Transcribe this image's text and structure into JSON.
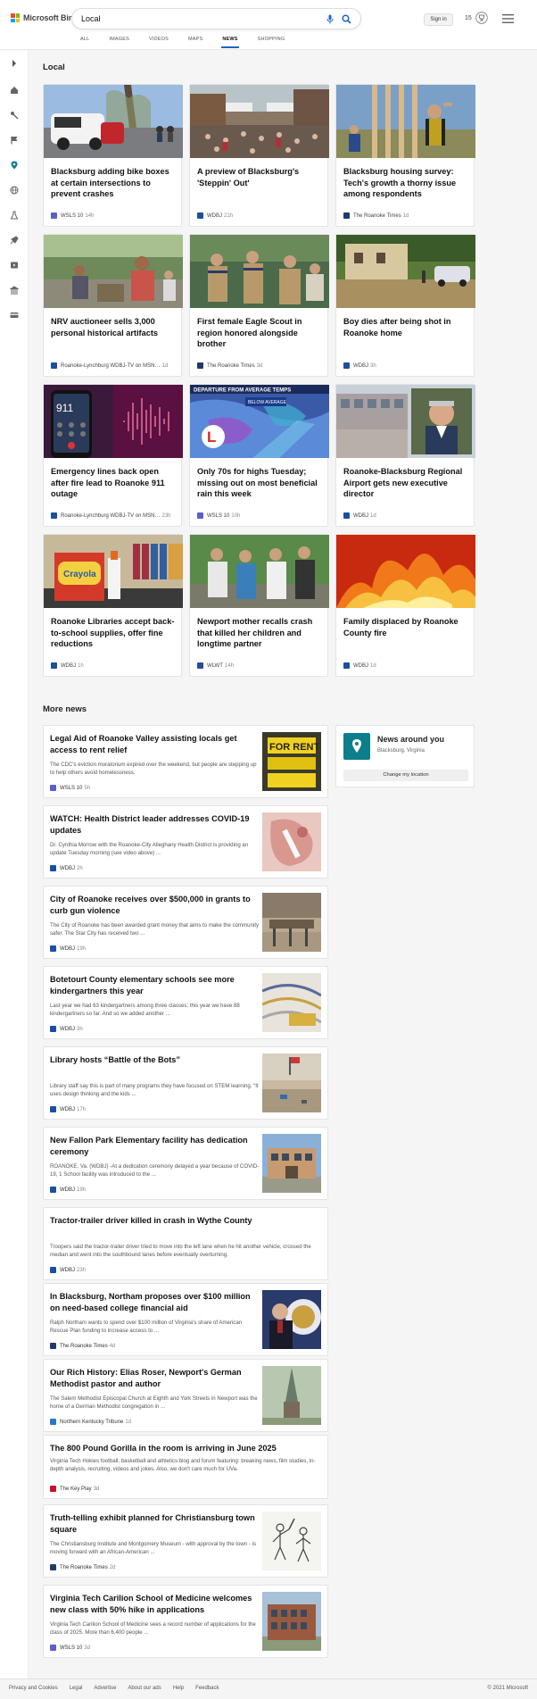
{
  "brand": {
    "name": "Microsoft Bing",
    "logo_colors": [
      "#f25022",
      "#7fba00",
      "#00a4ef",
      "#ffb900"
    ],
    "accent": "#1e65c9"
  },
  "search": {
    "query": "Local"
  },
  "header": {
    "sign_in": "Sign in",
    "reward_points": "15"
  },
  "tabs": [
    {
      "label": "ALL",
      "active": false
    },
    {
      "label": "IMAGES",
      "active": false
    },
    {
      "label": "VIDEOS",
      "active": false
    },
    {
      "label": "MAPS",
      "active": false
    },
    {
      "label": "NEWS",
      "active": true
    },
    {
      "label": "SHOPPING",
      "active": false
    }
  ],
  "sidebar": {
    "icons": [
      "expand-icon",
      "home-icon",
      "sports-icon",
      "flag-icon",
      "local-pin-icon",
      "world-icon",
      "science-icon",
      "tech-icon",
      "entertainment-icon",
      "politics-icon",
      "money-icon"
    ]
  },
  "local": {
    "heading": "Local",
    "cards": [
      {
        "title": "Blacksburg adding bike boxes at certain intersections to prevent crashes",
        "source": "WSLS 10",
        "time": "14h",
        "source_color": "#5b5fc7"
      },
      {
        "title": "A preview of Blacksburg's 'Steppin' Out'",
        "source": "WDBJ",
        "time": "21h",
        "source_color": "#1b4fa0"
      },
      {
        "title": "Blacksburg housing survey: Tech's growth a thorny issue among respondents",
        "source": "The Roanoke Times",
        "time": "1d",
        "source_color": "#1f3a6b"
      },
      {
        "title": "NRV auctioneer sells 3,000 personal historical artifacts",
        "source": "Roanoke-Lynchburg WDBJ-TV on MSN…",
        "time": "1d",
        "source_color": "#1b4fa0"
      },
      {
        "title": "First female Eagle Scout in region honored alongside brother",
        "source": "The Roanoke Times",
        "time": "3d",
        "source_color": "#1f3a6b"
      },
      {
        "title": "Boy dies after being shot in Roanoke home",
        "source": "WDBJ",
        "time": "3h",
        "source_color": "#1b4fa0"
      },
      {
        "title": "Emergency lines back open after fire lead to Roanoke 911 outage",
        "source": "Roanoke-Lynchburg WDBJ-TV on MSN…",
        "time": "23h",
        "source_color": "#1b4fa0"
      },
      {
        "title": "Only 70s for highs Tuesday; missing out on most beneficial rain this week",
        "source": "WSLS 10",
        "time": "10h",
        "source_color": "#5b5fc7"
      },
      {
        "title": "Roanoke-Blacksburg Regional Airport gets new executive director",
        "source": "WDBJ",
        "time": "1d",
        "source_color": "#1b4fa0"
      },
      {
        "title": "Roanoke Libraries accept back-to-school supplies, offer fine reductions",
        "source": "WDBJ",
        "time": "1h",
        "source_color": "#1b4fa0"
      },
      {
        "title": "Newport mother recalls crash that killed her children and longtime partner",
        "source": "WLWT",
        "time": "14h",
        "source_color": "#2b4a9b"
      },
      {
        "title": "Family displaced by Roanoke County fire",
        "source": "WDBJ",
        "time": "1d",
        "source_color": "#1b4fa0"
      }
    ],
    "overlay_text": {
      "weather_banner": "DEPARTURE FROM AVERAGE TEMPS",
      "weather_badge": "BELOW AVERAGE",
      "weather_logo": "L",
      "rent_sign": "FOR RENT"
    }
  },
  "more_news": {
    "heading": "More news",
    "items": [
      {
        "title": "Legal Aid of Roanoke Valley assisting locals get access to rent relief",
        "snippet": "The CDC's eviction moratorium expired over the weekend, but people are stepping up to help others avoid homelessness.",
        "source": "WSLS 10",
        "time": "5h",
        "source_color": "#5b5fc7"
      },
      {
        "title": "WATCH: Health District leader addresses COVID-19 updates",
        "snippet": "Dr. Cynthia Morrow with the Roanoke-City Alleghany Health District is providing an update Tuesday morning (see video above) ...",
        "source": "WDBJ",
        "time": "2h",
        "source_color": "#1b4fa0"
      },
      {
        "title": "City of Roanoke receives over $500,000 in grants to curb gun violence",
        "snippet": "The City of Roanoke has been awarded grant money that aims to make the community safer. The Star City has received two ...",
        "source": "WDBJ",
        "time": "19h",
        "source_color": "#1b4fa0"
      },
      {
        "title": "Botetourt County elementary schools see more kindergartners this year",
        "snippet": "Last year we had 63 kindergartners among three classes; this year we have 88 kindergartners so far. And so we added another ...",
        "source": "WDBJ",
        "time": "3h",
        "source_color": "#1b4fa0"
      },
      {
        "title": "Library hosts “Battle of the Bots”",
        "snippet": "Library staff say this is part of many programs they have focused on STEM learning. “It uses design thinking and the kids ...",
        "source": "WDBJ",
        "time": "17h",
        "source_color": "#1b4fa0"
      },
      {
        "title": "New Fallon Park Elementary facility has dedication ceremony",
        "snippet": "ROANOKE, Va. (WDBJ) -At a dedication ceremony delayed a year because of COVID-19, 1 School facility was introduced to the ...",
        "source": "WDBJ",
        "time": "19h",
        "source_color": "#1b4fa0"
      },
      {
        "title": "Tractor-trailer driver killed in crash in Wythe County",
        "snippet": "Troopers said the tractor-trailer driver tried to move into the left lane when he hit another vehicle, crossed the median and went into the southbound lanes before eventually overturning.",
        "source": "WDBJ",
        "time": "23h",
        "source_color": "#1b4fa0"
      },
      {
        "title": "In Blacksburg, Northam proposes over $100 million on need-based college financial aid",
        "snippet": "Ralph Northam wants to spend over $100 million of Virginia's share of American Rescue Plan funding to increase access to ...",
        "source": "The Roanoke Times",
        "time": "4d",
        "source_color": "#1f3a6b"
      },
      {
        "title": "Our Rich History: Elias Roser, Newport's German Methodist pastor and author",
        "snippet": "The Salem Methodist Episcopal Church at Eighth and York Streets in Newport was the home of a German Methodist congregation in ...",
        "source": "Northern Kentucky Tribune",
        "time": "1d",
        "source_color": "#2a78c8"
      },
      {
        "title": "The 800 Pound Gorilla in the room is arriving in June 2025",
        "snippet": "Virginia Tech Hokies football, basketball and athletics blog and forum featuring: breaking news, film studies, in-depth analysis, recruiting, videos and jokes. Also, we don't care much for UVa.",
        "source": "The Key Play",
        "time": "3d",
        "source_color": "#c8102e"
      },
      {
        "title": "Truth-telling exhibit planned for Christiansburg town square",
        "snippet": "The Christiansburg Institute and Montgomery Museum - with approval by the town - is moving forward with an African-American ...",
        "source": "The Roanoke Times",
        "time": "2d",
        "source_color": "#1f3a6b"
      },
      {
        "title": "Virginia Tech Carilion School of Medicine welcomes new class with 50% hike in applications",
        "snippet": "Virginia Tech Carilion School of Medicine sees a record number of applications for the class of 2025. More than 6,400 people ...",
        "source": "WSLS 10",
        "time": "3d",
        "source_color": "#5b5fc7"
      }
    ]
  },
  "news_around": {
    "title": "News around you",
    "location": "Blacksburg, Virginia",
    "button": "Change my location"
  },
  "footer": {
    "links": [
      "Privacy and Cookies",
      "Legal",
      "Advertise",
      "About our ads",
      "Help",
      "Feedback"
    ],
    "copyright": "© 2021 Microsoft"
  }
}
